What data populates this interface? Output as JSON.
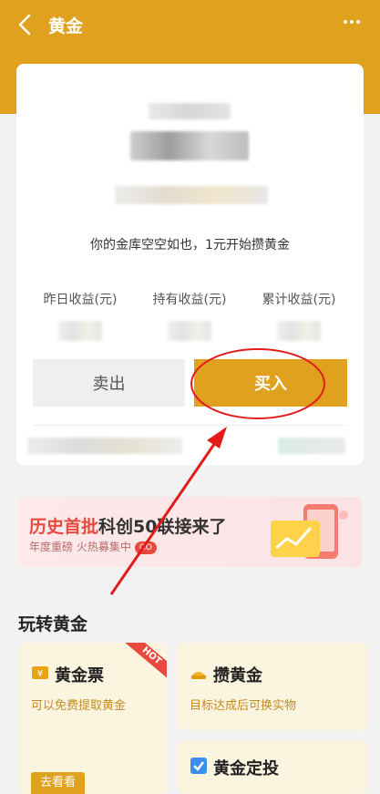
{
  "topbar": {
    "title": "黄金",
    "back_icon": "back-arrow-icon",
    "more_icon": "more-dots-icon"
  },
  "colors": {
    "brand": "#dfa11e",
    "highlight": "#e8493f"
  },
  "account": {
    "empty_text": "你的金库空空如也，1元开始攒黄金",
    "stats": [
      {
        "label": "昨日收益(元)"
      },
      {
        "label": "持有收益(元)"
      },
      {
        "label": "累计收益(元)"
      }
    ],
    "sell_label": "卖出",
    "buy_label": "买入"
  },
  "banner": {
    "title_red": "历史首批",
    "title_dark": "科创50联接来了",
    "subtitle": "年度重磅 火热募集中",
    "go": "GO"
  },
  "section": {
    "title": "玩转黄金"
  },
  "tiles": [
    {
      "name": "黄金票",
      "desc": "可以免费提取黄金",
      "badge": "HOT",
      "action": "去看看"
    },
    {
      "name": "攒黄金",
      "desc": "目标达成后可换实物"
    },
    {
      "name": "黄金定投"
    }
  ]
}
